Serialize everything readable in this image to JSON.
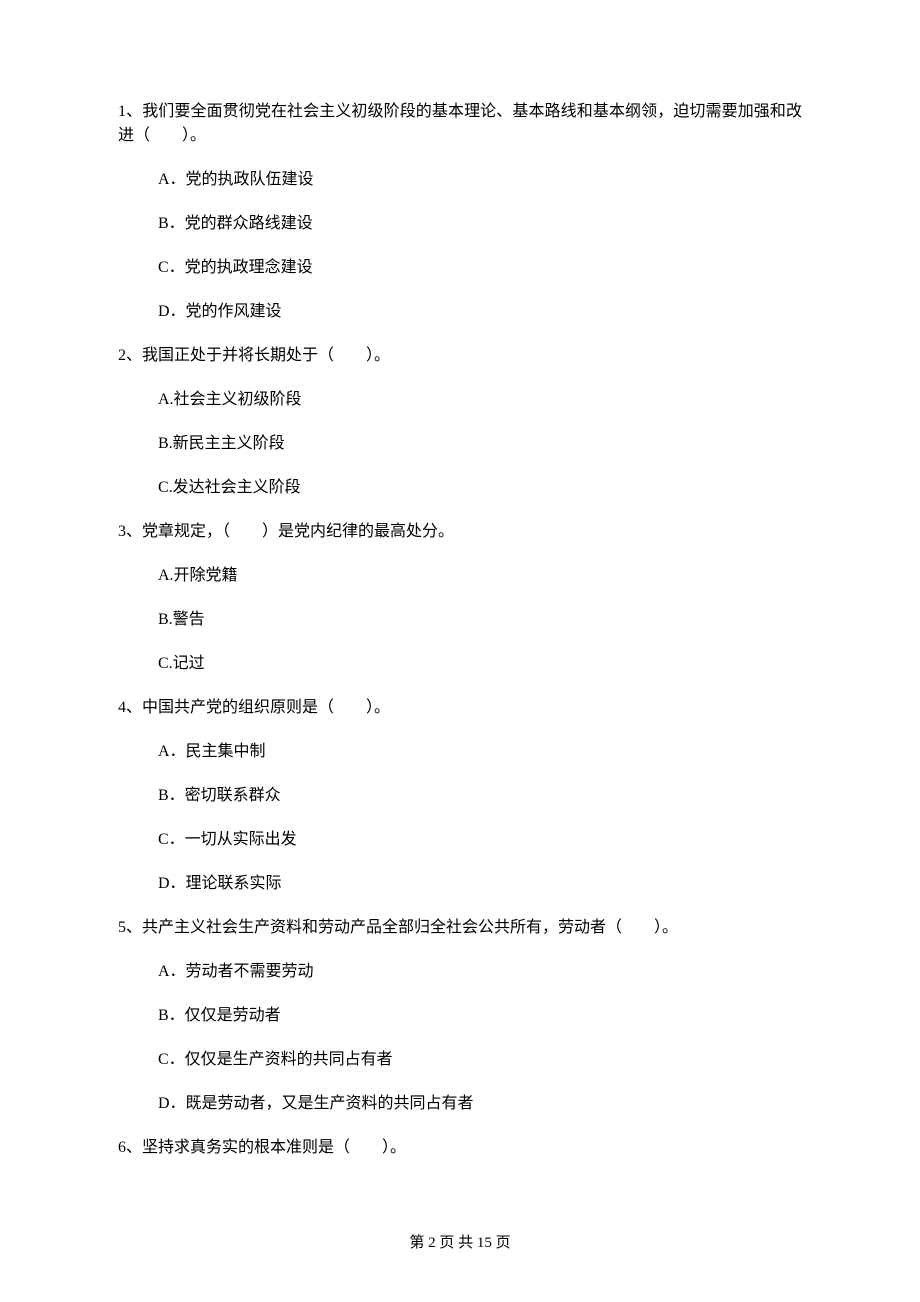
{
  "questions": [
    {
      "stem": "1、我们要全面贯彻党在社会主义初级阶段的基本理论、基本路线和基本纲领，迫切需要加强和改进（　　）。",
      "options": [
        "A．党的执政队伍建设",
        "B．党的群众路线建设",
        "C．党的执政理念建设",
        "D．党的作风建设"
      ]
    },
    {
      "stem": "2、我国正处于并将长期处于（　　）。",
      "options": [
        "A.社会主义初级阶段",
        "B.新民主主义阶段",
        "C.发达社会主义阶段"
      ]
    },
    {
      "stem": "3、党章规定，（　　）是党内纪律的最高处分。",
      "options": [
        "A.开除党籍",
        "B.警告",
        "C.记过"
      ]
    },
    {
      "stem": "4、中国共产党的组织原则是（　　）。",
      "options": [
        "A．民主集中制",
        "B．密切联系群众",
        "C．一切从实际出发",
        "D．理论联系实际"
      ]
    },
    {
      "stem": "5、共产主义社会生产资料和劳动产品全部归全社会公共所有，劳动者（　　）。",
      "options": [
        "A．劳动者不需要劳动",
        "B．仅仅是劳动者",
        "C．仅仅是生产资料的共同占有者",
        "D．既是劳动者，又是生产资料的共同占有者"
      ]
    },
    {
      "stem": "6、坚持求真务实的根本准则是（　　）。",
      "options": []
    }
  ],
  "footer": "第 2 页 共 15 页"
}
